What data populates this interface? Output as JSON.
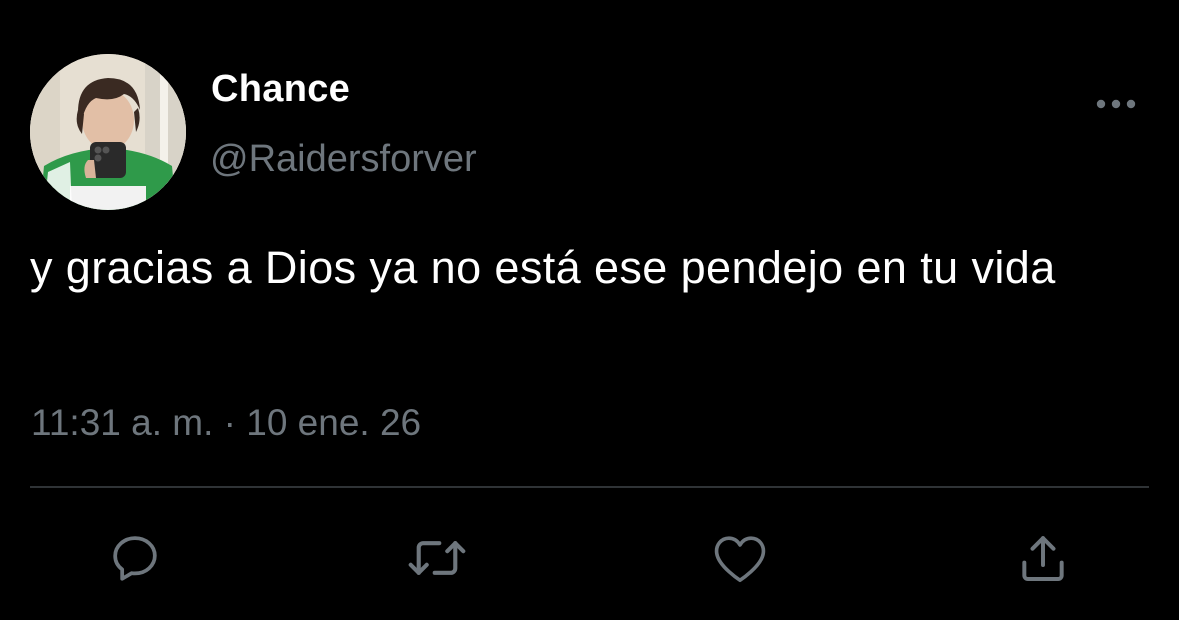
{
  "tweet": {
    "author": {
      "display_name": "Chance",
      "handle": "@Raidersforver"
    },
    "text": "y gracias a Dios ya no está ese pendejo en tu vida",
    "timestamp": "11:31 a. m. · 10 ene. 26"
  },
  "actions": {
    "reply": {
      "icon": "reply-icon"
    },
    "retweet": {
      "icon": "retweet-icon"
    },
    "like": {
      "icon": "heart-icon"
    },
    "share": {
      "icon": "share-icon"
    }
  },
  "colors": {
    "background": "#000000",
    "text_primary": "#ffffff",
    "text_secondary": "#6e767d",
    "divider": "#2f3336"
  }
}
